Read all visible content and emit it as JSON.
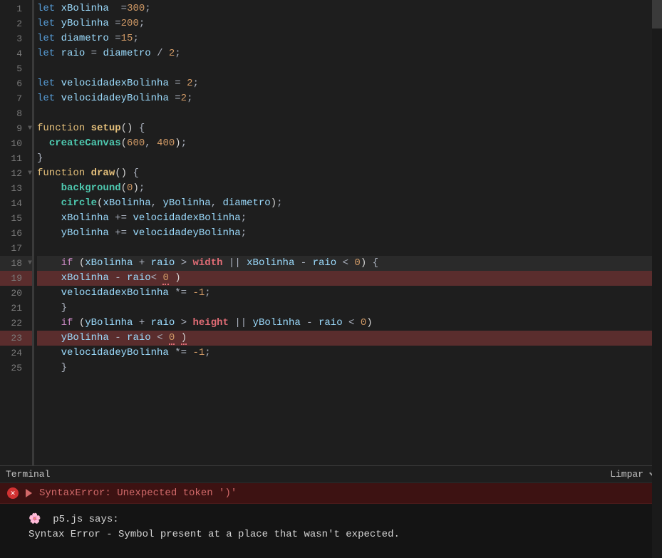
{
  "code_lines": [
    {
      "num": "1"
    },
    {
      "num": "2"
    },
    {
      "num": "3"
    },
    {
      "num": "4"
    },
    {
      "num": "5"
    },
    {
      "num": "6"
    },
    {
      "num": "7"
    },
    {
      "num": "8"
    },
    {
      "num": "9",
      "fold": "▼"
    },
    {
      "num": "10"
    },
    {
      "num": "11"
    },
    {
      "num": "12",
      "fold": "▼"
    },
    {
      "num": "13"
    },
    {
      "num": "14"
    },
    {
      "num": "15"
    },
    {
      "num": "16"
    },
    {
      "num": "17"
    },
    {
      "num": "18",
      "fold": "▼"
    },
    {
      "num": "19"
    },
    {
      "num": "20"
    },
    {
      "num": "21"
    },
    {
      "num": "22"
    },
    {
      "num": "23"
    },
    {
      "num": "24"
    },
    {
      "num": "25"
    }
  ],
  "tokens": {
    "let": "let",
    "function": "function",
    "if": "if",
    "xBolinha": "xBolinha",
    "yBolinha": "yBolinha",
    "diametro": "diametro",
    "raio": "raio",
    "velocidadexBolinha": "velocidadexBolinha",
    "velocidadeyBolinha": "velocidadeyBolinha",
    "setup": "setup",
    "draw": "draw",
    "createCanvas": "createCanvas",
    "background": "background",
    "circle": "circle",
    "width": "width",
    "height": "height",
    "n300": "300",
    "n200": "200",
    "n15": "15",
    "n2": "2",
    "n600": "600",
    "n400": "400",
    "n0": "0",
    "nMinus1": "-1",
    "eq": "=",
    "plusEq": "+=",
    "mulEq": "*=",
    "plus": "+",
    "minus": "-",
    "div": "/",
    "gt": ">",
    "lt": "<",
    "or": "||",
    "semi": ";",
    "comma": ",",
    "lparen": "(",
    "rparen": ")",
    "lbrace": "{",
    "rbrace": "}"
  },
  "terminal": {
    "title": "Terminal",
    "clear": "Limpar",
    "error": "SyntaxError: Unexpected token ')'",
    "p5_prefix": "🌸  p5.js says:",
    "p5_msg": "Syntax Error - Symbol present at a place that wasn't expected."
  }
}
